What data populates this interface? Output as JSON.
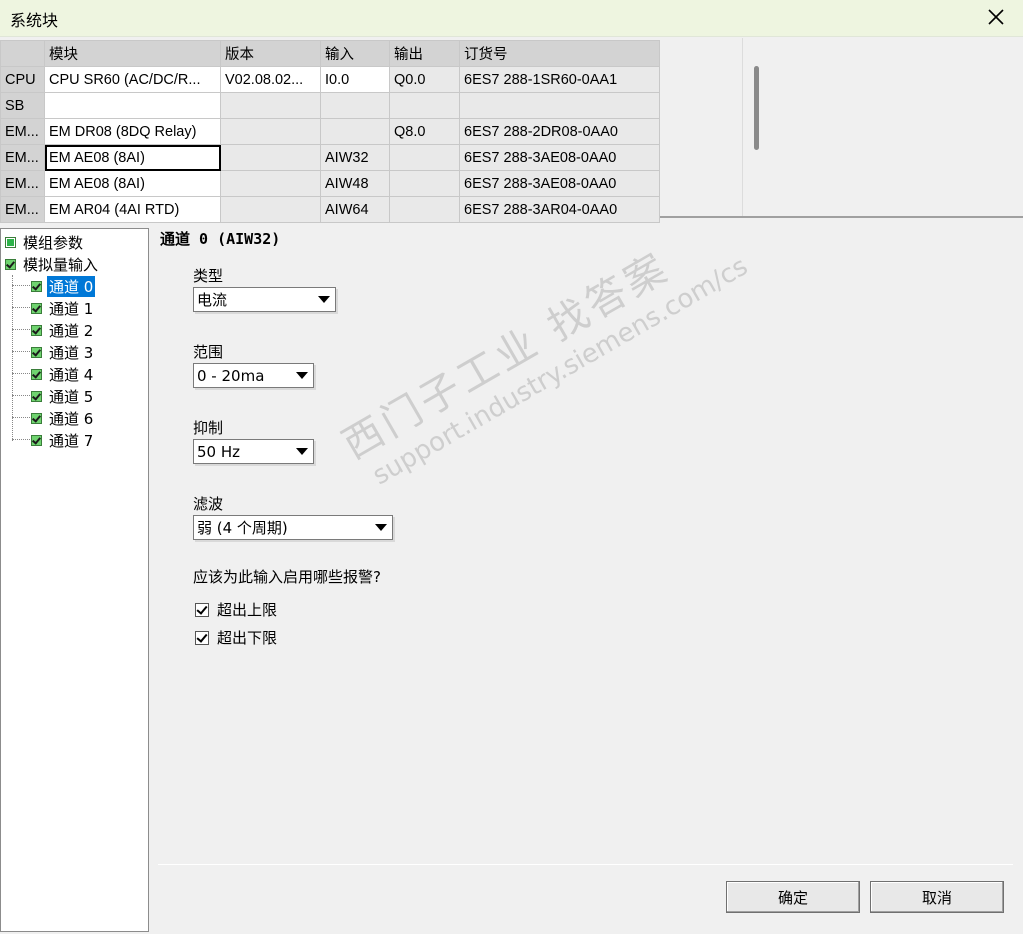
{
  "window": {
    "title": "系统块",
    "close_icon": "close-icon"
  },
  "table": {
    "headers": [
      "",
      "模块",
      "版本",
      "输入",
      "输出",
      "订货号"
    ],
    "rows": [
      {
        "type": "CPU",
        "module": "CPU SR60 (AC/DC/R...",
        "version": "V02.08.02...",
        "input": "I0.0",
        "output": "Q0.0",
        "order": "6ES7 288-1SR60-0AA1"
      },
      {
        "type": "SB",
        "module": "",
        "version": "",
        "input": "",
        "output": "",
        "order": ""
      },
      {
        "type": "EM...",
        "module": "EM DR08 (8DQ Relay)",
        "version": "",
        "input": "",
        "output": "Q8.0",
        "order": "6ES7 288-2DR08-0AA0"
      },
      {
        "type": "EM...",
        "module": "EM AE08 (8AI)",
        "version": "",
        "input": "AIW32",
        "output": "",
        "order": "6ES7 288-3AE08-0AA0"
      },
      {
        "type": "EM...",
        "module": "EM AE08 (8AI)",
        "version": "",
        "input": "AIW48",
        "output": "",
        "order": "6ES7 288-3AE08-0AA0"
      },
      {
        "type": "EM...",
        "module": "EM AR04 (4AI RTD)",
        "version": "",
        "input": "AIW64",
        "output": "",
        "order": "6ES7 288-3AR04-0AA0"
      }
    ]
  },
  "tree": {
    "items": [
      {
        "label": "模组参数",
        "level": 0
      },
      {
        "label": "模拟量输入",
        "level": 0
      },
      {
        "label": "通道 0",
        "level": 1,
        "selected": true
      },
      {
        "label": "通道 1",
        "level": 1
      },
      {
        "label": "通道 2",
        "level": 1
      },
      {
        "label": "通道 3",
        "level": 1
      },
      {
        "label": "通道 4",
        "level": 1
      },
      {
        "label": "通道 5",
        "level": 1
      },
      {
        "label": "通道 6",
        "level": 1
      },
      {
        "label": "通道 7",
        "level": 1
      }
    ]
  },
  "panel": {
    "heading": "通道 0 (AIW32)",
    "type_label": "类型",
    "type_value": "电流",
    "range_label": "范围",
    "range_value": "0 - 20ma",
    "rejection_label": "抑制",
    "rejection_value": "50 Hz",
    "filter_label": "滤波",
    "filter_value": "弱 (4 个周期)",
    "alarm_question": "应该为此输入启用哪些报警?",
    "alarm_high": "超出上限",
    "alarm_high_checked": true,
    "alarm_low": "超出下限",
    "alarm_low_checked": true
  },
  "buttons": {
    "ok": "确定",
    "cancel": "取消"
  },
  "watermark": {
    "line1": "西门子工业   找答案",
    "line2": "support.industry.siemens.com/cs"
  }
}
